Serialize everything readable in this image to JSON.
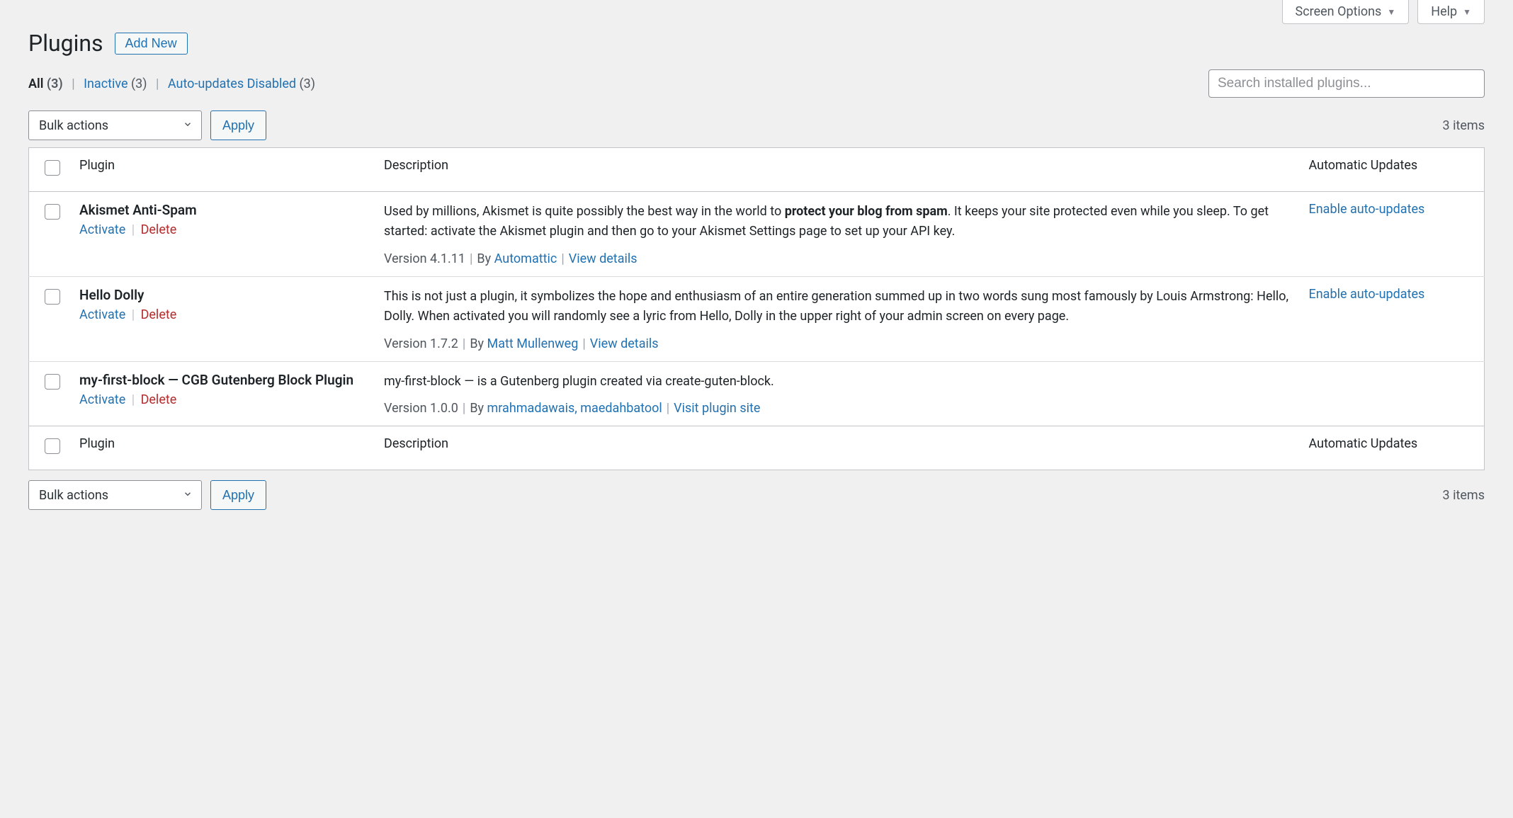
{
  "screen_tabs": {
    "screen_options": "Screen Options",
    "help": "Help"
  },
  "heading": "Plugins",
  "add_new": "Add New",
  "filters": {
    "all_label": "All",
    "all_count": "(3)",
    "inactive_label": "Inactive",
    "inactive_count": "(3)",
    "auto_disabled_label": "Auto-updates Disabled",
    "auto_disabled_count": "(3)"
  },
  "search_placeholder": "Search installed plugins...",
  "bulk_actions_label": "Bulk actions",
  "apply_label": "Apply",
  "items_count": "3 items",
  "columns": {
    "plugin": "Plugin",
    "description": "Description",
    "auto": "Automatic Updates"
  },
  "row_action_labels": {
    "activate": "Activate",
    "delete": "Delete",
    "enable_auto": "Enable auto-updates"
  },
  "plugins": [
    {
      "name": "Akismet Anti-Spam",
      "desc_pre": "Used by millions, Akismet is quite possibly the best way in the world to ",
      "desc_bold": "protect your blog from spam",
      "desc_post": ". It keeps your site protected even while you sleep. To get started: activate the Akismet plugin and then go to your Akismet Settings page to set up your API key.",
      "version_text": "Version 4.1.11",
      "by_text": "By ",
      "author": "Automattic",
      "details_label": "View details",
      "show_auto": true
    },
    {
      "name": "Hello Dolly",
      "desc_pre": "This is not just a plugin, it symbolizes the hope and enthusiasm of an entire generation summed up in two words sung most famously by Louis Armstrong: Hello, Dolly. When activated you will randomly see a lyric from Hello, Dolly in the upper right of your admin screen on every page.",
      "desc_bold": "",
      "desc_post": "",
      "version_text": "Version 1.7.2",
      "by_text": "By ",
      "author": "Matt Mullenweg",
      "details_label": "View details",
      "show_auto": true
    },
    {
      "name": "my-first-block — CGB Gutenberg Block Plugin",
      "desc_pre": "my-first-block — is a Gutenberg plugin created via create-guten-block.",
      "desc_bold": "",
      "desc_post": "",
      "version_text": "Version 1.0.0",
      "by_text": "By ",
      "author": "mrahmadawais, maedahbatool",
      "details_label": "Visit plugin site",
      "show_auto": false
    }
  ]
}
